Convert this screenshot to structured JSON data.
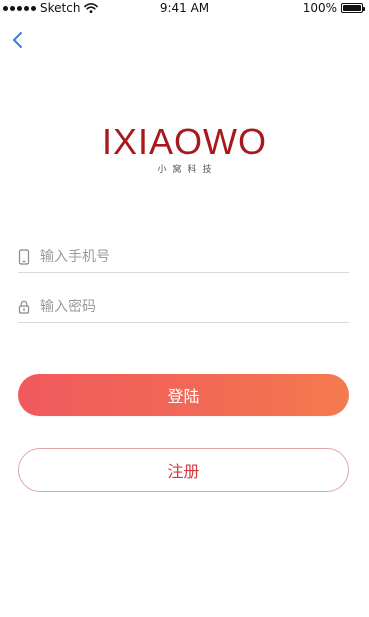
{
  "status_bar": {
    "carrier": "Sketch",
    "time": "9:41 AM",
    "battery": "100%",
    "signal_icon": "signal-dots-icon",
    "wifi_icon": "wifi-icon",
    "battery_icon": "battery-icon",
    "battery_level": 1.0
  },
  "nav": {
    "back_icon": "chevron-left-icon",
    "accent_color": "#3b7ce0"
  },
  "logo": {
    "mark": "IXIAOWO",
    "tagline": "小窝科技",
    "color": "#a8191e"
  },
  "form": {
    "phone": {
      "icon": "phone-icon",
      "placeholder": "输入手机号",
      "value": ""
    },
    "password": {
      "icon": "lock-icon",
      "placeholder": "输入密码",
      "value": ""
    }
  },
  "actions": {
    "login_label": "登陆",
    "register_label": "注册",
    "login_gradient": [
      "#f1595d",
      "#f47b4e"
    ],
    "register_border_color": "#e0a6aa",
    "register_text_color": "#d2383f"
  }
}
